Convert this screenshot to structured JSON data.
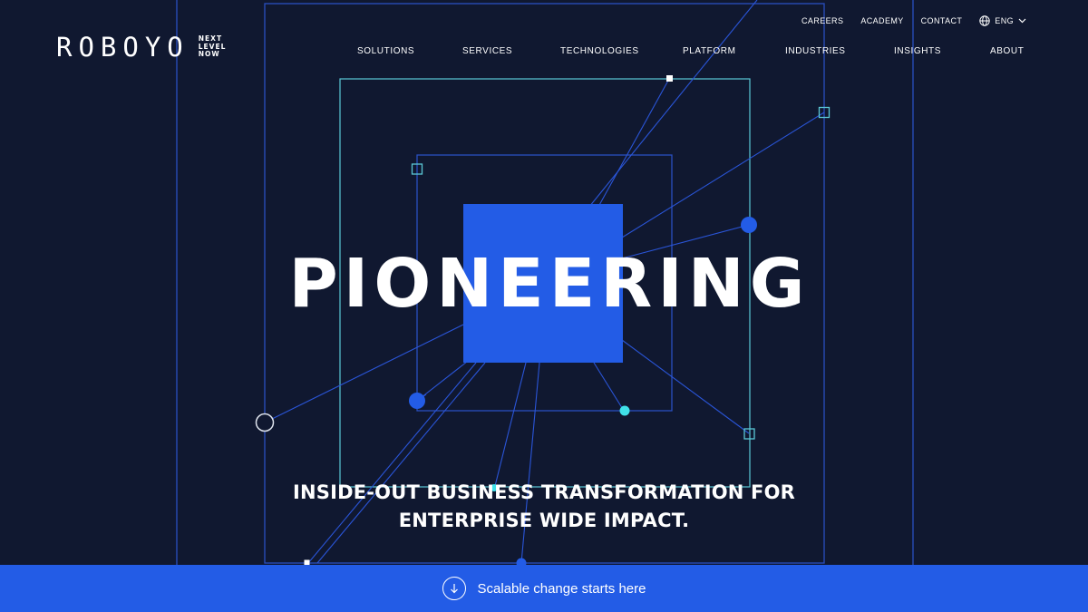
{
  "logo": {
    "wordmark": "ROBOYO",
    "tagline": [
      "NEXT",
      "LEVEL",
      "NOW"
    ]
  },
  "utility_nav": {
    "careers": "CAREERS",
    "academy": "ACADEMY",
    "contact": "CONTACT",
    "language": "ENG"
  },
  "main_nav": [
    "SOLUTIONS",
    "SERVICES",
    "TECHNOLOGIES",
    "PLATFORM",
    "INDUSTRIES",
    "INSIGHTS",
    "ABOUT"
  ],
  "hero": {
    "headline": "PIONEERING",
    "subtitle_line1": "INSIDE-OUT BUSINESS TRANSFORMATION FOR",
    "subtitle_line2": "ENTERPRISE WIDE IMPACT."
  },
  "cta": {
    "label": "Scalable change starts here"
  },
  "colors": {
    "background": "#101830",
    "accent_blue": "#235ce6",
    "cyan": "#40e0e8",
    "frame_blue": "#2a4fc0",
    "teal_line": "#5bc8d6"
  },
  "icons": {
    "language": "globe-icon",
    "dropdown": "chevron-down-icon",
    "scroll": "arrow-down-circle-icon"
  }
}
